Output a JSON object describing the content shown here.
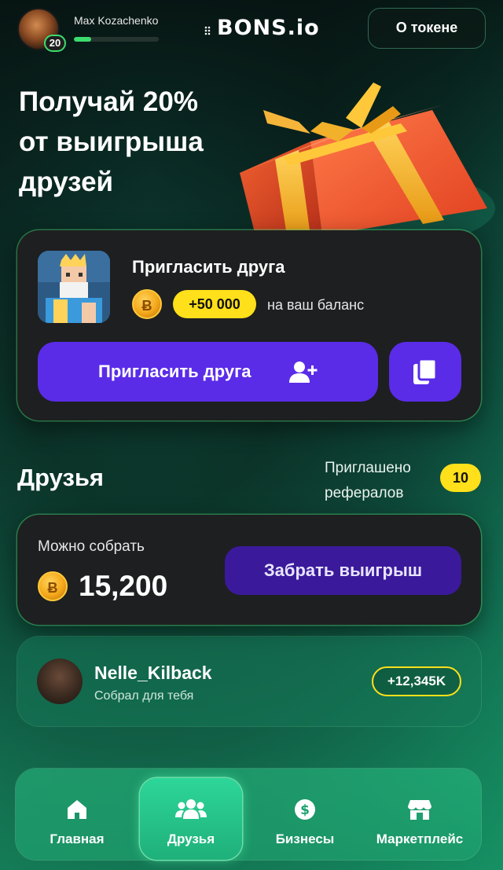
{
  "header": {
    "username": "Max Kozachenko",
    "level": "20",
    "xp_progress": 0.2,
    "logo": "BONS.io",
    "token_button": "О токене"
  },
  "hero": {
    "line1": "Получай 20%",
    "line2": "от выигрыша",
    "line3": "друзей"
  },
  "invite": {
    "title": "Пригласить друга",
    "coin_symbol": "Ƀ",
    "reward": "+50 000",
    "reward_note": "на ваш баланс",
    "button_label": "Пригласить друга"
  },
  "friends": {
    "title": "Друзья",
    "referrals_label_1": "Приглашено",
    "referrals_label_2": "рефералов",
    "referrals_count": "10"
  },
  "collect": {
    "label": "Можно собрать",
    "amount": "15,200",
    "button_label": "Забрать выигрыш"
  },
  "friend_list": [
    {
      "name": "Nelle_Kilback",
      "subtitle": "Собрал для тебя",
      "amount": "+12,345K"
    }
  ],
  "nav": {
    "items": [
      {
        "label": "Главная",
        "icon": "home-icon"
      },
      {
        "label": "Друзья",
        "icon": "people-icon",
        "active": true
      },
      {
        "label": "Бизнесы",
        "icon": "dollar-icon"
      },
      {
        "label": "Маркетплейс",
        "icon": "store-icon"
      }
    ]
  },
  "colors": {
    "accent_purple": "#5a2ce8",
    "accent_yellow": "#ffe01a",
    "accent_green": "#3cdc6e"
  }
}
